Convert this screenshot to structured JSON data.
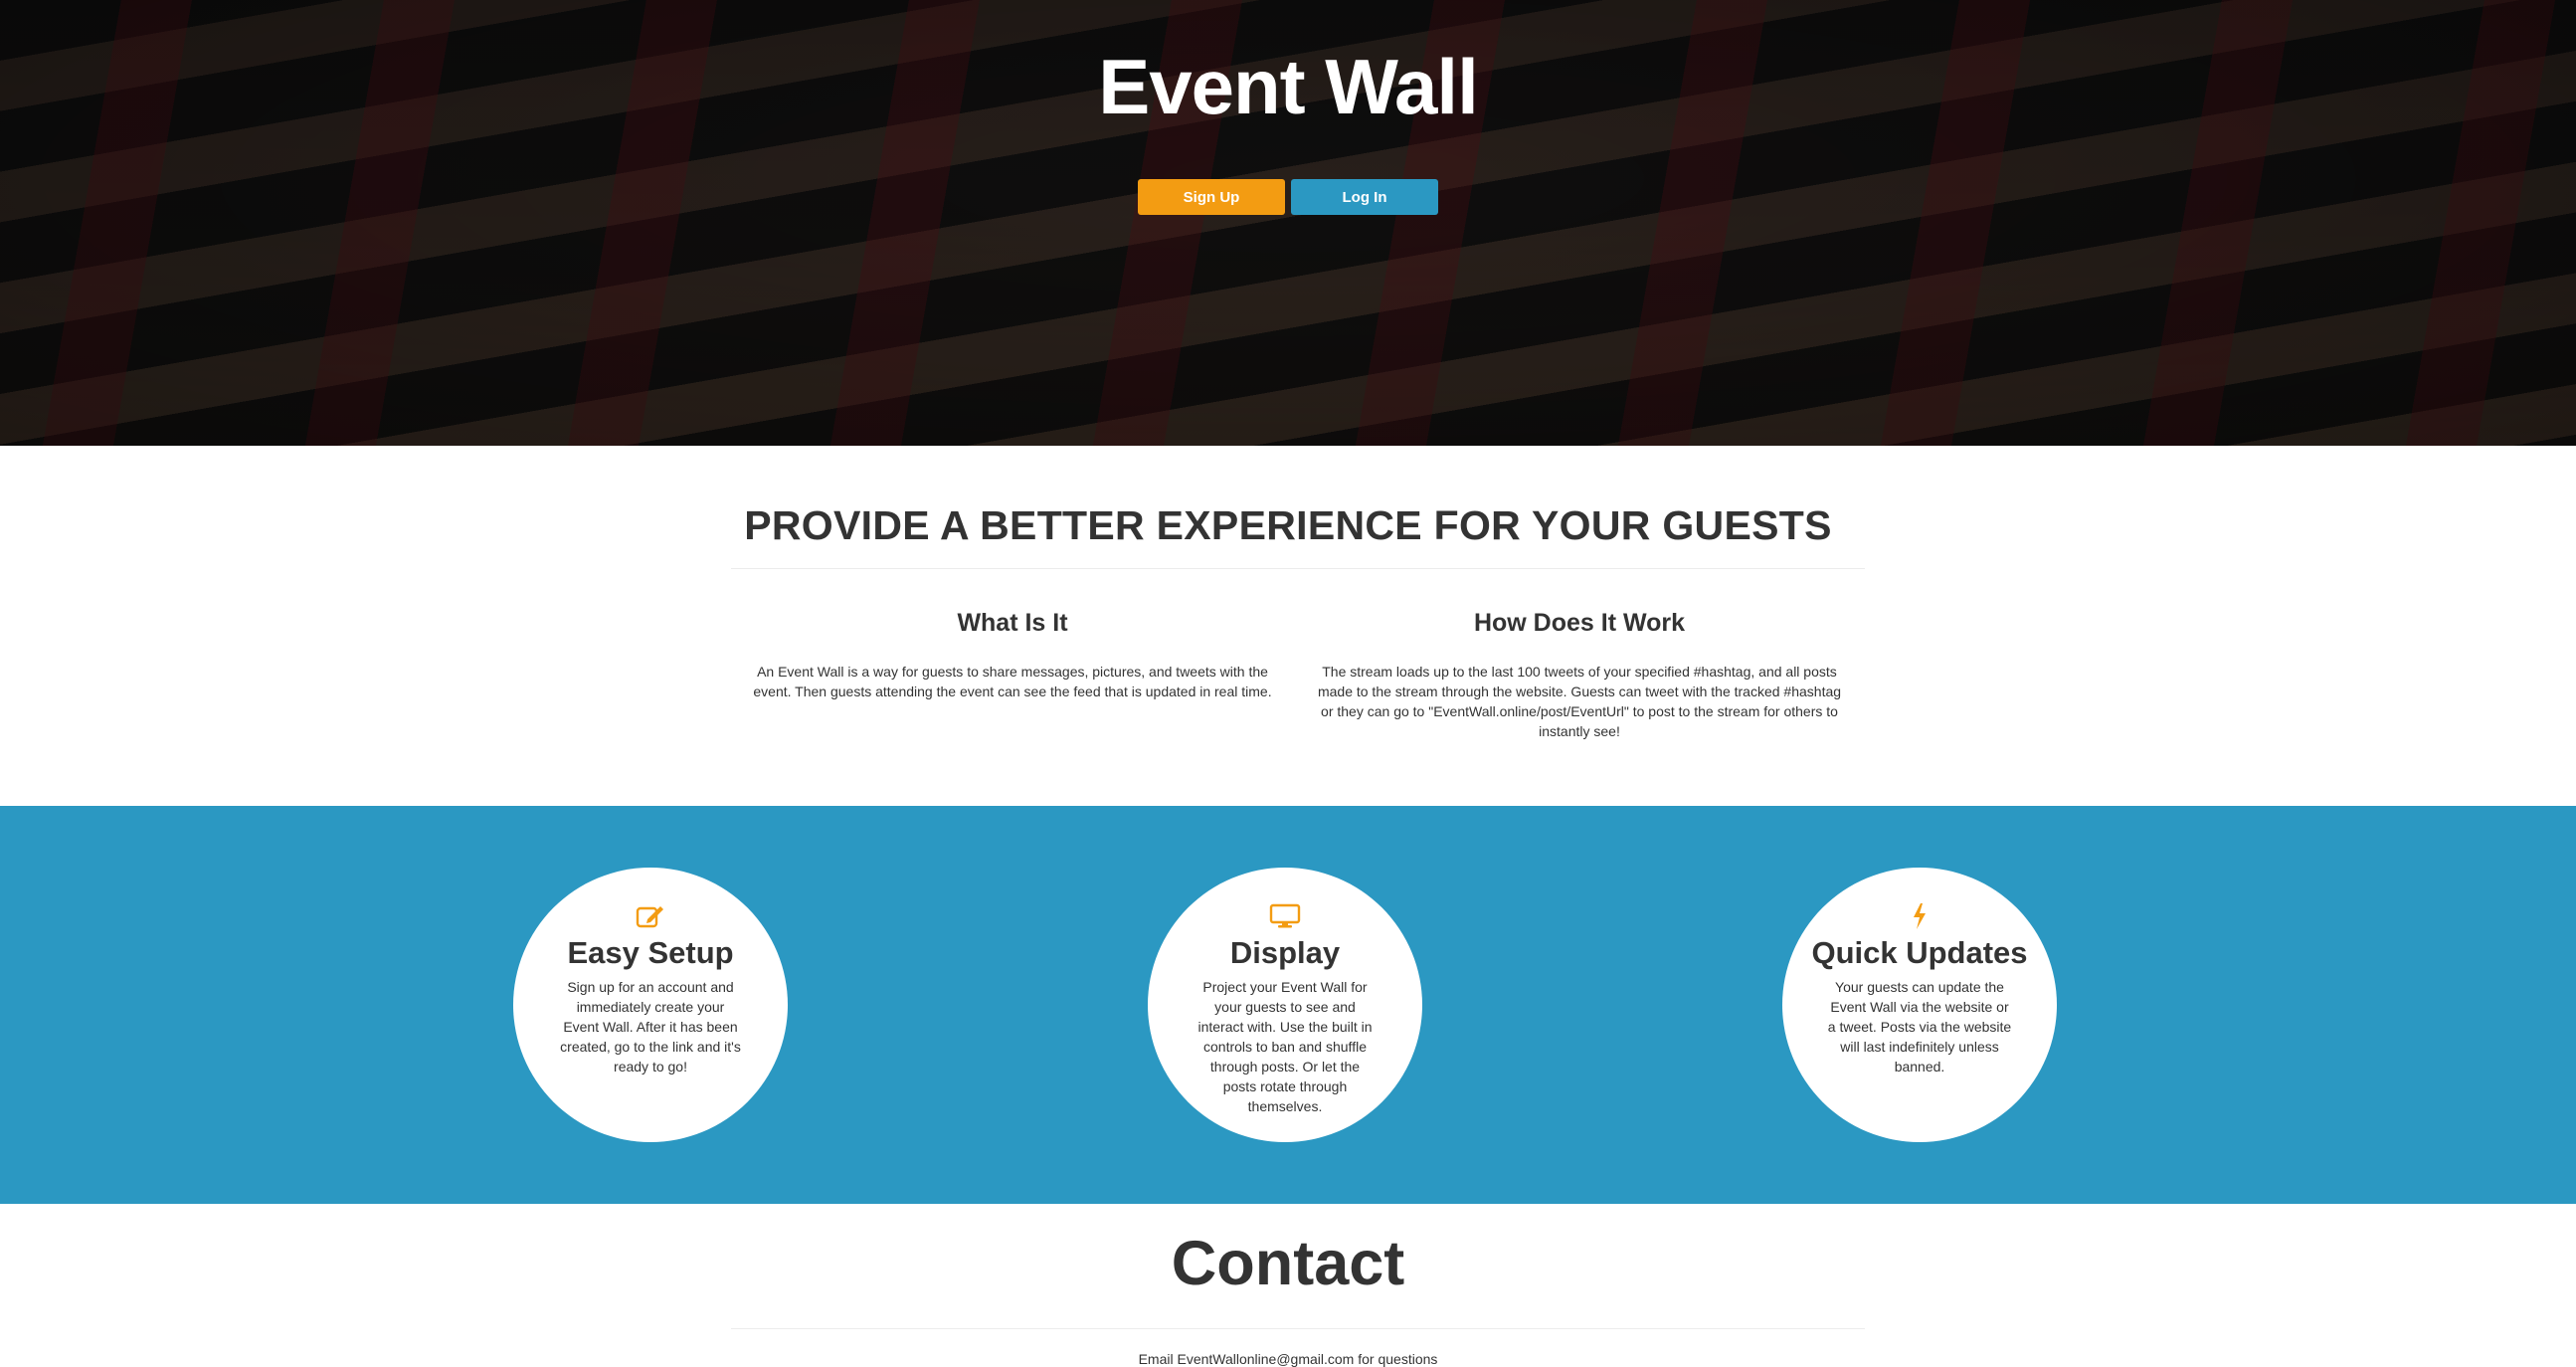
{
  "hero": {
    "title": "Event Wall",
    "signup_label": "Sign Up",
    "login_label": "Log In"
  },
  "intro": {
    "heading": "PROVIDE A BETTER EXPERIENCE FOR YOUR GUESTS",
    "what": {
      "title": "What Is It",
      "body": "An Event Wall is a way for guests to share messages, pictures, and tweets with the event. Then guests attending the event can see the feed that is updated in real time."
    },
    "how": {
      "title": "How Does It Work",
      "body": "The stream loads up to the last 100 tweets of your specified #hashtag, and all posts made to the stream through the website. Guests can tweet with the tracked #hashtag or they can go to \"EventWall.online/post/EventUrl\" to post to the stream for others to instantly see!"
    }
  },
  "features": [
    {
      "icon": "edit-icon",
      "title": "Easy Setup",
      "body": "Sign up for an account and immediately create your Event Wall. After it has been created, go to the link and it's ready to go!"
    },
    {
      "icon": "monitor-icon",
      "title": "Display",
      "body": "Project your Event Wall for your guests to see and interact with. Use the built in controls to ban and shuffle through posts. Or let the posts rotate through themselves."
    },
    {
      "icon": "lightning-icon",
      "title": "Quick Updates",
      "body": "Your guests can update the Event Wall via the website or a tweet. Posts via the website will last indefinitely unless banned."
    }
  ],
  "contact": {
    "title": "Contact",
    "line": "Email EventWallonline@gmail.com for questions"
  },
  "colors": {
    "accent_orange": "#f39c12",
    "accent_blue": "#2b98c2",
    "text": "#333333"
  }
}
